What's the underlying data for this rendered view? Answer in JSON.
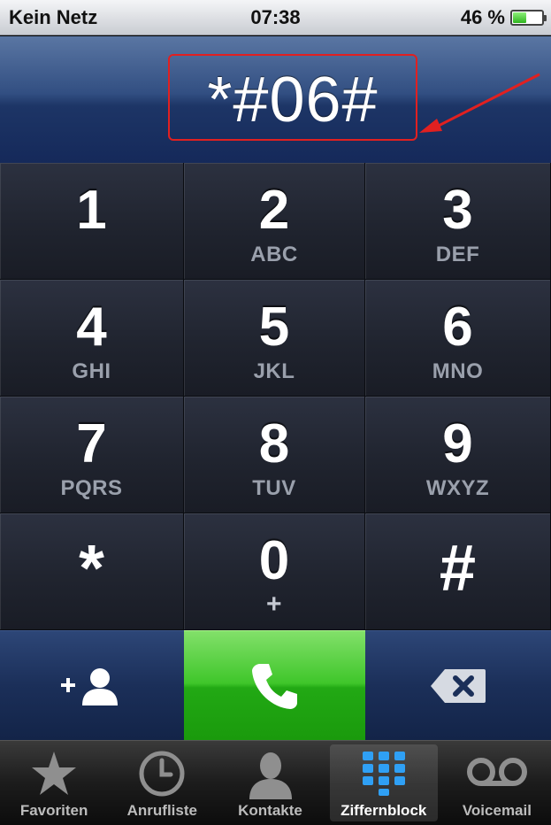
{
  "status_bar": {
    "carrier": "Kein Netz",
    "time": "07:38",
    "battery_percent": "46 %",
    "battery_level": 0.46
  },
  "display": {
    "dialed_number": "*#06#"
  },
  "keys": [
    {
      "digit": "1",
      "letters": ""
    },
    {
      "digit": "2",
      "letters": "ABC"
    },
    {
      "digit": "3",
      "letters": "DEF"
    },
    {
      "digit": "4",
      "letters": "GHI"
    },
    {
      "digit": "5",
      "letters": "JKL"
    },
    {
      "digit": "6",
      "letters": "MNO"
    },
    {
      "digit": "7",
      "letters": "PQRS"
    },
    {
      "digit": "8",
      "letters": "TUV"
    },
    {
      "digit": "9",
      "letters": "WXYZ"
    },
    {
      "digit": "*",
      "letters": ""
    },
    {
      "digit": "0",
      "letters": "+"
    },
    {
      "digit": "#",
      "letters": ""
    }
  ],
  "actions": {
    "add": "add-contact-icon",
    "call": "phone-icon",
    "delete": "backspace-icon"
  },
  "tabs": [
    {
      "label": "Favoriten",
      "icon": "star-icon"
    },
    {
      "label": "Anrufliste",
      "icon": "clock-icon"
    },
    {
      "label": "Kontakte",
      "icon": "person-icon"
    },
    {
      "label": "Ziffernblock",
      "icon": "keypad-icon",
      "active": true
    },
    {
      "label": "Voicemail",
      "icon": "voicemail-icon"
    }
  ],
  "colors": {
    "call_green": "#2fb51f",
    "annotation_red": "#e12020",
    "display_blue": "#1d3566"
  }
}
